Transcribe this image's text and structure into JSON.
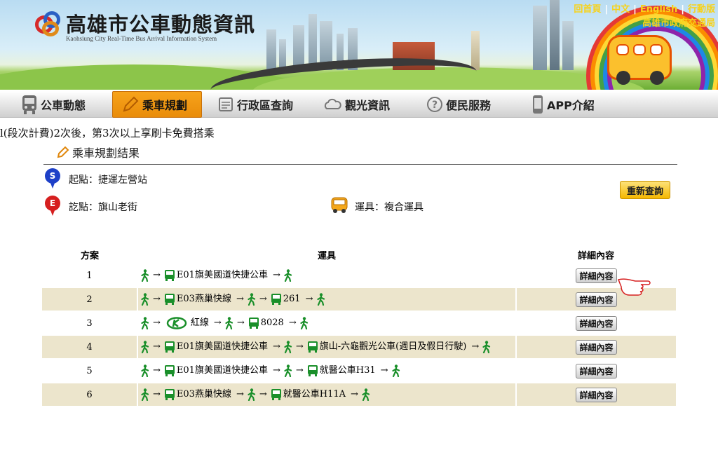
{
  "header": {
    "site_title": "高雄市公車動態資訊",
    "site_subtitle": "Kaohsiung City Real-Time Bus Arrival Information System",
    "top_links": [
      "回首頁",
      "中文",
      "English",
      "行動版"
    ],
    "bureau_name": "高雄市政府交通局"
  },
  "nav": {
    "items": [
      {
        "label": "公車動態",
        "icon": "bus-icon"
      },
      {
        "label": "乘車規劃",
        "icon": "pencil-icon",
        "active": true
      },
      {
        "label": "行政區查詢",
        "icon": "document-icon"
      },
      {
        "label": "觀光資訊",
        "icon": "cloud-icon"
      },
      {
        "label": "便民服務",
        "icon": "question-icon"
      },
      {
        "label": "APP介紹",
        "icon": "phone-icon"
      }
    ]
  },
  "notice": "l(段次計費)2次後，第3次以上享刷卡免費搭乘",
  "result": {
    "heading": "乘車規劃結果",
    "start_label": "起點：捷運左營站",
    "end_label": "訖點：旗山老街",
    "vehicle_label": "運具：複合運具",
    "requery_button": "重新查詢",
    "start_pin_letter": "S",
    "end_pin_letter": "E"
  },
  "table": {
    "headers": {
      "plan": "方案",
      "vehicle": "運具",
      "detail": "詳細內容"
    },
    "detail_button": "詳細內容",
    "rows": [
      {
        "plan": "1",
        "segments": [
          "walk",
          "bus:E01旗美國道快捷公車",
          "walk"
        ]
      },
      {
        "plan": "2",
        "segments": [
          "walk",
          "bus:E03燕巢快線",
          "walk",
          "bus:261",
          "walk"
        ]
      },
      {
        "plan": "3",
        "segments": [
          "walk",
          "mrt:紅線",
          "walk",
          "bus:8028",
          "walk"
        ]
      },
      {
        "plan": "4",
        "segments": [
          "walk",
          "bus:E01旗美國道快捷公車",
          "walk",
          "bus:旗山-六龜觀光公車(週日及假日行駛)",
          "walk"
        ]
      },
      {
        "plan": "5",
        "segments": [
          "walk",
          "bus:E01旗美國道快捷公車",
          "walk",
          "bus:就醫公車H31",
          "walk"
        ]
      },
      {
        "plan": "6",
        "segments": [
          "walk",
          "bus:E03燕巢快線",
          "walk",
          "bus:就醫公車H11A",
          "walk"
        ]
      }
    ]
  },
  "colors": {
    "accent_orange": "#f09a12",
    "row_stripe": "#ece5cc",
    "walk_green": "#1a8f2a",
    "start_pin": "#1e40c8",
    "end_pin": "#d61f1f"
  }
}
